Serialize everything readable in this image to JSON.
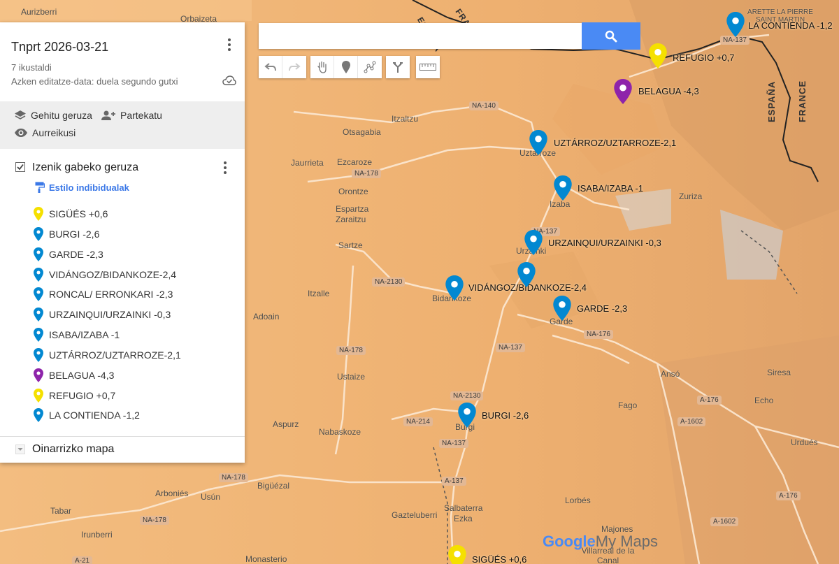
{
  "map": {
    "title": "Tnprt 2026-03-21",
    "views": "7 ikustaldi",
    "last_edited": "Azken editatze-data: duela segundo gutxi",
    "actions": {
      "add_layer": "Gehitu geruza",
      "share": "Partekatu",
      "preview": "Aurreikusi"
    },
    "layer": {
      "title": "Izenik gabeko geruza",
      "style": "Estilo indibidualak",
      "items": [
        {
          "label": "SIGÜÉS +0,6",
          "color": "#f5e000"
        },
        {
          "label": "BURGI -2,6",
          "color": "#0288d1"
        },
        {
          "label": "GARDE -2,3",
          "color": "#0288d1"
        },
        {
          "label": "VIDÁNGOZ/BIDANKOZE-2,4",
          "color": "#0288d1"
        },
        {
          "label": "RONCAL/ ERRONKARI -2,3",
          "color": "#0288d1"
        },
        {
          "label": "URZAINQUI/URZAINKI -0,3",
          "color": "#0288d1"
        },
        {
          "label": "ISABA/IZABA -1",
          "color": "#0288d1"
        },
        {
          "label": "UZTÁRROZ/UZTARROZE-2,1",
          "color": "#0288d1"
        },
        {
          "label": "BELAGUA -4,3",
          "color": "#8e24aa"
        },
        {
          "label": "REFUGIO +0,7",
          "color": "#f5e000"
        },
        {
          "label": "LA CONTIENDA -1,2",
          "color": "#0288d1"
        }
      ]
    },
    "basemap_label": "Oinarrizko mapa"
  },
  "search": {
    "placeholder": ""
  },
  "markers": [
    {
      "label": "LA CONTIENDA -1,2",
      "color": "#0288d1"
    },
    {
      "label": "REFUGIO +0,7",
      "color": "#f5e000"
    },
    {
      "label": "BELAGUA -4,3",
      "color": "#8e24aa"
    },
    {
      "label": "UZTÁRROZ/UZTARROZE-2,1",
      "color": "#0288d1"
    },
    {
      "label": "ISABA/IZABA -1",
      "color": "#0288d1"
    },
    {
      "label": "URZAINQUI/URZAINKI -0,3",
      "color": "#0288d1"
    },
    {
      "label": "VIDÁNGOZ/BIDANKOZE-2,4",
      "color": "#0288d1"
    },
    {
      "label": "RONCAL",
      "color": "#0288d1"
    },
    {
      "label": "GARDE -2,3",
      "color": "#0288d1"
    },
    {
      "label": "BURGI -2,6",
      "color": "#0288d1"
    },
    {
      "label": "SIGÜÉS +0,6",
      "color": "#f5e000"
    }
  ],
  "places": [
    "Aurizberri",
    "Orbaizeta",
    "Itzaltzu",
    "Otsagabia",
    "Jaurrieta",
    "Ezcaroze",
    "Orontze",
    "Espartza",
    "Zaraitzu",
    "Sartze",
    "Itzalle",
    "Adoain",
    "Ustaize",
    "Aspurz",
    "Nabaskoze",
    "Bigüézal",
    "Arboniés",
    "Tabar",
    "Usún",
    "Irunberri",
    "Gazteluberri",
    "Salbaterra",
    "Ezka",
    "Monasterio",
    "Uztarroze",
    "Izaba",
    "Urzainki",
    "Bidankoze",
    "Garde",
    "Burgi",
    "Zuriza",
    "Ansó",
    "Fago",
    "Siresa",
    "Echo",
    "Lorbés",
    "Urdués",
    "Majones",
    "Villarreal de la Canal",
    "ARETTE LA PIERRE SAINT MARTIN"
  ],
  "roads": [
    "NA-140",
    "NA-178",
    "NA-137",
    "NA-2130",
    "NA-178",
    "NA-137",
    "NA-176",
    "NA-2130",
    "NA-214",
    "NA-137",
    "A-137",
    "NA-178",
    "NA-178",
    "A-176",
    "A-1602",
    "A-176",
    "A-1602",
    "A-21",
    "NA-137"
  ],
  "borders": [
    "ESPAÑA",
    "FRANCE",
    "ESPAÑA",
    "FRANCE"
  ],
  "logo": {
    "google": "Google",
    "mymaps": "My Maps"
  }
}
